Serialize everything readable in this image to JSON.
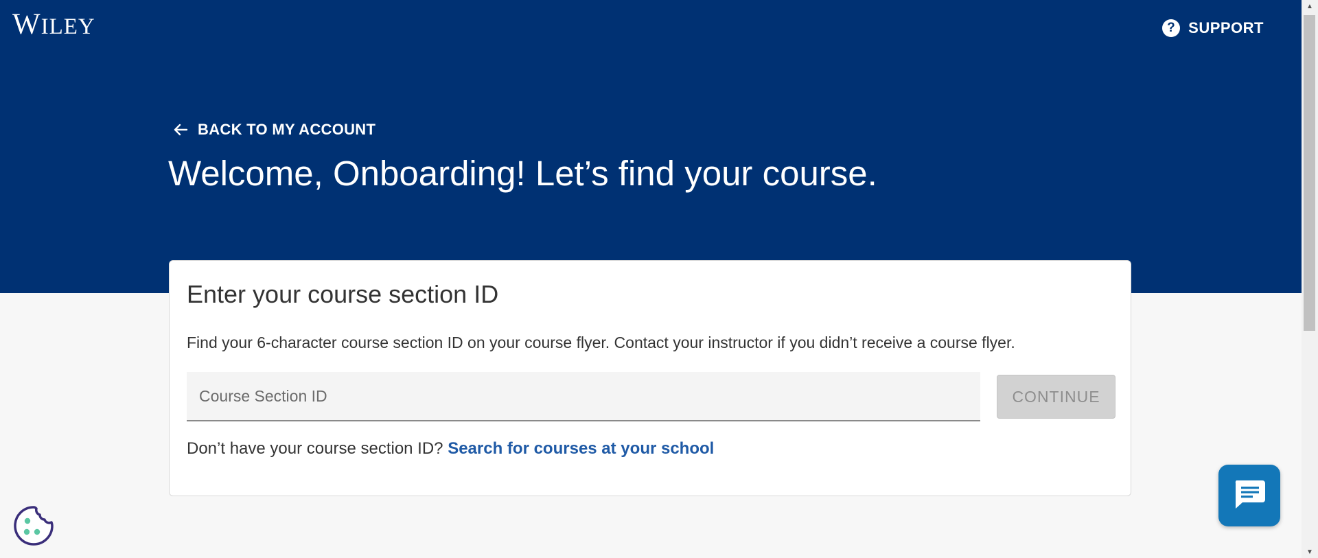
{
  "header": {
    "logo_text": "Wiley",
    "logo_first": "W",
    "logo_rest": "ILEY",
    "support_label": "SUPPORT",
    "support_icon": "?"
  },
  "hero": {
    "back_label": "BACK TO MY ACCOUNT",
    "welcome_title": "Welcome, Onboarding! Let’s find your course."
  },
  "card": {
    "title": "Enter your course section ID",
    "description": "Find your 6-character course section ID on your course flyer. Contact your instructor if you didn’t receive a course flyer.",
    "input_placeholder": "Course Section ID",
    "input_value": "",
    "continue_label": "CONTINUE",
    "footer_text": "Don’t have your course section ID?",
    "footer_link": "Search for courses at your school"
  },
  "icons": {
    "support": "question-circle-icon",
    "back": "arrow-left-icon",
    "chat": "chat-bubble-icon",
    "cookie": "cookie-icon"
  },
  "colors": {
    "brand_navy": "#003173",
    "link_blue": "#1f5aa6",
    "chat_blue": "#1377b8",
    "disabled_gray": "#d2d2d2",
    "cookie_dots": "#5bc7a3",
    "cookie_outline": "#3a2e7a"
  }
}
